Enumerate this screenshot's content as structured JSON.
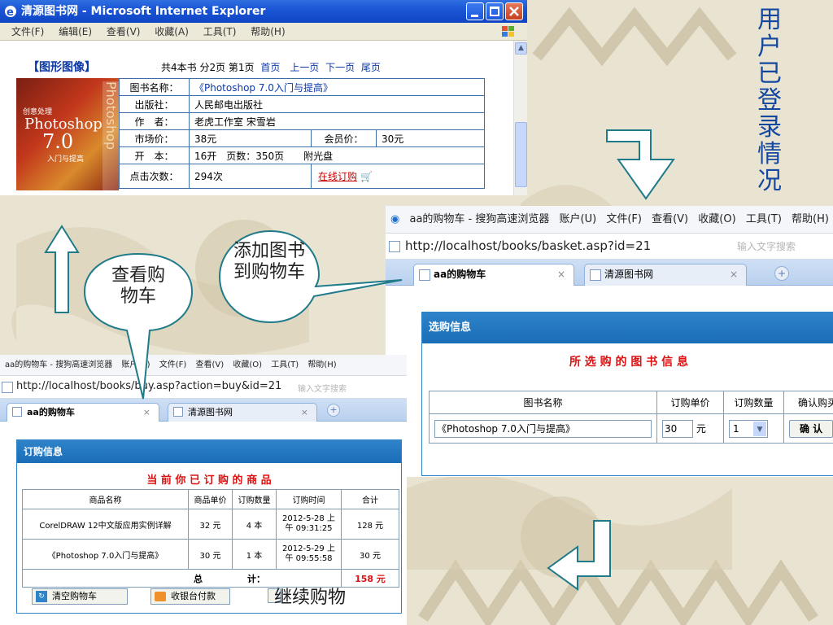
{
  "side_title": "用户已登录情况",
  "callouts": {
    "view_cart": "查看购物车",
    "add_book": "添加图书到购物车"
  },
  "continue_label": "继续购物",
  "ie": {
    "title": "清源图书网 - Microsoft Internet Explorer",
    "menu": [
      "文件(F)",
      "编辑(E)",
      "查看(V)",
      "收藏(A)",
      "工具(T)",
      "帮助(H)"
    ],
    "category": "【图形图像】",
    "pagination": "共4本书 分2页 第1页",
    "nav": [
      "首页",
      "上一页",
      "下一页",
      "尾页"
    ],
    "cover": {
      "line1": "创意处理",
      "line2": "Photoshop",
      "line3": "7.0",
      "line4": "入门与提高"
    },
    "rows": {
      "name_label": "图书名称：",
      "name": "《Photoshop 7.0入门与提高》",
      "publisher_label": "出版社：",
      "publisher": "人民邮电出版社",
      "author_label": "作　者：",
      "author": "老虎工作室 宋雪岩",
      "price_label": "市场价：",
      "price": "38元",
      "member_label": "会员价：",
      "member_price": "30元",
      "format_label": "开　本：",
      "format": "16开　页数：350页　　附光盘",
      "clicks_label": "点击次数：",
      "clicks": "294次",
      "order_link": "在线订购"
    }
  },
  "basket": {
    "menu_title": "aa的购物车 - 搜狗高速浏览器",
    "menu": [
      "账户(U)",
      "文件(F)",
      "查看(V)",
      "收藏(O)",
      "工具(T)",
      "帮助(H)"
    ],
    "url": "http://localhost/books/basket.asp?id=21",
    "search_placeholder": "输入文字搜索",
    "tab1": "aa的购物车",
    "tab2": "清源图书网",
    "panel_title": "选购信息",
    "heading": "所 选 购 的 图 书 信 息",
    "columns": [
      "图书名称",
      "订购单价",
      "订购数量",
      "确认购买"
    ],
    "book": "《Photoshop 7.0入门与提高》",
    "price": "30",
    "unit": "元",
    "qty": "1",
    "confirm": "确 认"
  },
  "buy": {
    "menu_title": "aa的购物车 - 搜狗高速浏览器",
    "menu": [
      "账户(U)",
      "文件(F)",
      "查看(V)",
      "收藏(O)",
      "工具(T)",
      "帮助(H)"
    ],
    "url": "http://localhost/books/buy.asp?action=buy&id=21",
    "search_placeholder": "输入文字搜索",
    "tab1": "aa的购物车",
    "tab2": "清源图书网",
    "panel_title": "订购信息",
    "heading": "当 前 你 已 订 购 的 商 品",
    "columns": [
      "商品名称",
      "商品单价",
      "订购数量",
      "订购时间",
      "合计"
    ],
    "items": [
      {
        "name": "CorelDRAW 12中文版应用实例详解",
        "price": "32 元",
        "qty": "4 本",
        "time1": "2012-5-28 上",
        "time2": "午 09:31:25",
        "total": "128 元"
      },
      {
        "name": "《Photoshop 7.0入门与提高》",
        "price": "30 元",
        "qty": "1 本",
        "time1": "2012-5-29 上",
        "time2": "午 09:55:58",
        "total": "30 元"
      }
    ],
    "total_label": "总　　　　　计：",
    "total": "158 元",
    "clear_btn": "清空购物车",
    "checkout_btn": "收银台付款"
  }
}
